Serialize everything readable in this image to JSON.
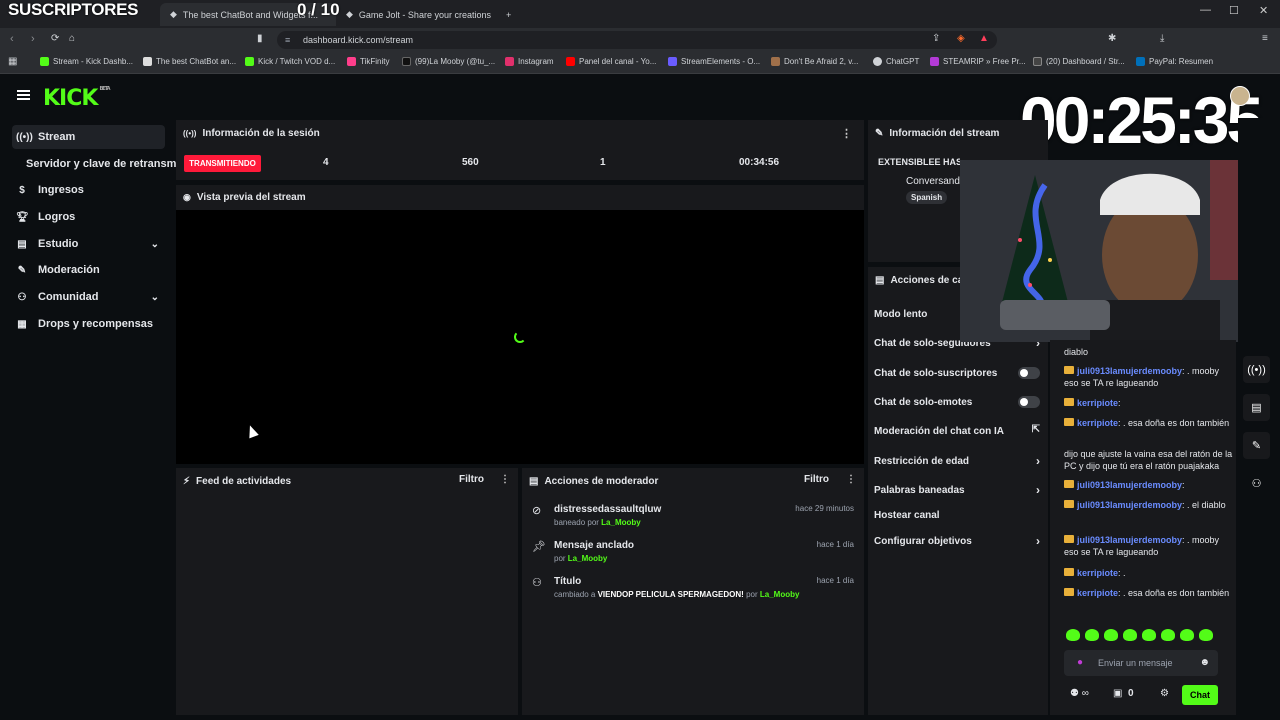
{
  "browser": {
    "tabs": [
      {
        "label": "The best ChatBot and Widgets f..."
      },
      {
        "label": "Game Jolt - Share your creations"
      }
    ],
    "url": "dashboard.kick.com/stream",
    "bookmarks": [
      "Stream - Kick Dashb...",
      "The best ChatBot an...",
      "Kick / Twitch VOD d...",
      "TikFinity",
      "(99)La Mooby (@tu_...",
      "Instagram",
      "Panel del canal - Yo...",
      "StreamElements - O...",
      "Don't Be Afraid 2, v...",
      "ChatGPT",
      "STEAMRIP » Free Pr...",
      "(20) Dashboard / Str...",
      "PayPal: Resumen"
    ]
  },
  "overlay": {
    "subs_label": "SUSCRIPTORES",
    "subs_count": "0 / 10",
    "timer": "00:25:35"
  },
  "sidebar": {
    "items": [
      {
        "label": "Stream",
        "icon": "broadcast-icon"
      },
      {
        "label": "Servidor y clave de retransmisión"
      },
      {
        "label": "Ingresos",
        "icon": "dollar-icon"
      },
      {
        "label": "Logros",
        "icon": "trophy-icon"
      },
      {
        "label": "Estudio",
        "icon": "layers-icon"
      },
      {
        "label": "Moderación",
        "icon": "wrench-icon"
      },
      {
        "label": "Comunidad",
        "icon": "users-icon"
      },
      {
        "label": "Drops y recompensas",
        "icon": "gift-icon"
      }
    ]
  },
  "session": {
    "title": "Información de la sesión",
    "status": "TRANSMITIENDO",
    "viewers": "4",
    "followers": "560",
    "subs": "1",
    "duration": "00:34:56"
  },
  "preview": {
    "title": "Vista previa del stream"
  },
  "feed": {
    "title": "Feed de actividades",
    "filter": "Filtro"
  },
  "modactions": {
    "title": "Acciones de moderador",
    "filter": "Filtro",
    "items": [
      {
        "title": "distressedassaultqluw",
        "sub_prefix": "baneado por",
        "by": "La_Mooby",
        "time": "hace 29 minutos"
      },
      {
        "title": "Mensaje anclado",
        "sub_prefix": "por",
        "by": "La_Mooby",
        "time": "hace 1 día"
      },
      {
        "title": "Título",
        "sub_prefix": "cambiado a",
        "value": "VIENDOP PELICULA SPERMAGEDON!",
        "sub_mid": "por",
        "by": "La_Mooby",
        "time": "hace 1 día"
      }
    ]
  },
  "streaminfo": {
    "title": "Información del stream",
    "stream_title": "EXTENSIBLEE HASTA QUE SE ACABE EL AÑO???",
    "category": "Conversand",
    "tag": "Spanish"
  },
  "channel_actions": {
    "title": "Acciones de ca",
    "items": [
      {
        "label": "Modo lento"
      },
      {
        "label": "Chat de solo-seguidores"
      },
      {
        "label": "Chat de solo-suscriptores"
      },
      {
        "label": "Chat de solo-emotes"
      },
      {
        "label": "Moderación del chat con IA"
      },
      {
        "label": "Restricción de edad"
      },
      {
        "label": "Palabras baneadas"
      },
      {
        "label": "Hostear canal"
      },
      {
        "label": "Configurar objetivos"
      }
    ]
  },
  "chat": {
    "messages": [
      {
        "user": "",
        "text": "diablo"
      },
      {
        "user": "juli0913lamujerdemooby",
        "text": ": . mooby eso se TA re lagueando"
      },
      {
        "user": "kerripiote",
        "text": ":"
      },
      {
        "user": "kerripiote",
        "text": ": . esa doña es don también"
      },
      {
        "user": "",
        "text": "dijo que ajuste la vaina esa del ratón de la PC y dijo que tú era el ratón puajakaka"
      },
      {
        "user": "juli0913lamujerdemooby",
        "text": ":"
      },
      {
        "user": "juli0913lamujerdemooby",
        "text": ": . el diablo"
      },
      {
        "user": "juli0913lamujerdemooby",
        "text": ": . mooby eso se TA re lagueando"
      },
      {
        "user": "kerripiote",
        "text": ": ."
      },
      {
        "user": "kerripiote",
        "text": ": . esa doña es don también"
      }
    ],
    "placeholder": "Enviar un mensaje",
    "count": "0",
    "send": "Chat"
  },
  "colors": {
    "accent": "#53fc18",
    "live": "#ff1a3a",
    "panel": "#18191c",
    "bg": "#0b0e11"
  }
}
